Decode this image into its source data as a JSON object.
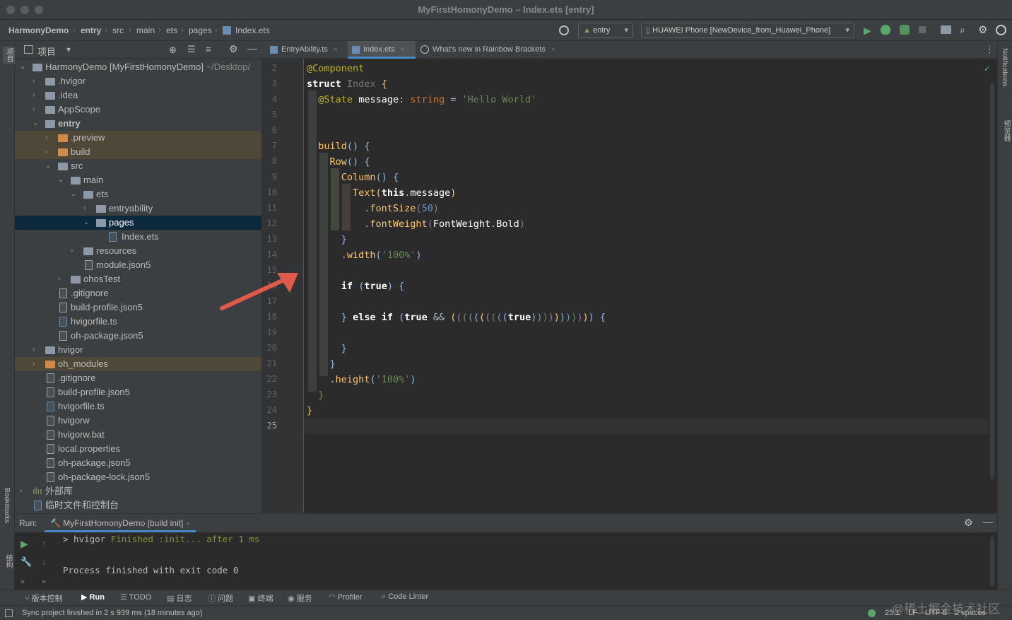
{
  "window": {
    "title": "MyFirstHomonyDemo – Index.ets [entry]"
  },
  "breadcrumb": [
    "HarmonyDemo",
    "entry",
    "src",
    "main",
    "ets",
    "pages",
    "Index.ets"
  ],
  "toolbar": {
    "module": "entry",
    "device": "HUAWEI Phone [NewDevice_from_Huawei_Phone]"
  },
  "project_panel": {
    "title": "项目",
    "tree": [
      {
        "label": "HarmonyDemo [MyFirstHomonyDemo]",
        "suffix": "~/Desktop/"
      },
      {
        "label": ".hvigor"
      },
      {
        "label": ".idea"
      },
      {
        "label": "AppScope"
      },
      {
        "label": "entry"
      },
      {
        "label": ".preview"
      },
      {
        "label": "build"
      },
      {
        "label": "src"
      },
      {
        "label": "main"
      },
      {
        "label": "ets"
      },
      {
        "label": "entryability"
      },
      {
        "label": "pages"
      },
      {
        "label": "Index.ets"
      },
      {
        "label": "resources"
      },
      {
        "label": "module.json5"
      },
      {
        "label": "ohosTest"
      },
      {
        "label": ".gitignore"
      },
      {
        "label": "build-profile.json5"
      },
      {
        "label": "hvigorfile.ts"
      },
      {
        "label": "oh-package.json5"
      },
      {
        "label": "hvigor"
      },
      {
        "label": "oh_modules"
      },
      {
        "label": ".gitignore"
      },
      {
        "label": "build-profile.json5"
      },
      {
        "label": "hvigorfile.ts"
      },
      {
        "label": "hvigorw"
      },
      {
        "label": "hvigorw.bat"
      },
      {
        "label": "local.properties"
      },
      {
        "label": "oh-package.json5"
      },
      {
        "label": "oh-package-lock.json5"
      },
      {
        "label": "外部库"
      },
      {
        "label": "临时文件和控制台"
      }
    ]
  },
  "editor_tabs": [
    "EntryAbility.ts",
    "Index.ets",
    "What's new in Rainbow Brackets"
  ],
  "line_numbers": [
    "2",
    "3",
    "4",
    "5",
    "6",
    "7",
    "8",
    "9",
    "10",
    "11",
    "12",
    "13",
    "14",
    "15",
    "16",
    "17",
    "18",
    "19",
    "20",
    "21",
    "22",
    "23",
    "24",
    "25"
  ],
  "run_panel": {
    "label": "Run:",
    "tab": "MyFirstHomonyDemo [build init]",
    "output_line1": "> hvigor ",
    "output_finished": "Finished :init... after 1 ms",
    "output_line2": "Process finished with exit code 0"
  },
  "bottom_tools": [
    "版本控制",
    "Run",
    "TODO",
    "日志",
    "问题",
    "终端",
    "服务",
    "Profiler",
    "Code Linter"
  ],
  "side_labels": {
    "left_top": "项目",
    "left_bookmarks": "Bookmarks",
    "left_structure": "结构",
    "right_notifications": "Notifications",
    "right_preview": "预览器"
  },
  "status": {
    "message": "Sync project finished in 2 s 939 ms (18 minutes ago)",
    "position": "25:1",
    "line_sep": "LF",
    "encoding": "UTF-8",
    "indent": "2 spaces",
    "watermark": "@稀土掘金技术社区"
  }
}
